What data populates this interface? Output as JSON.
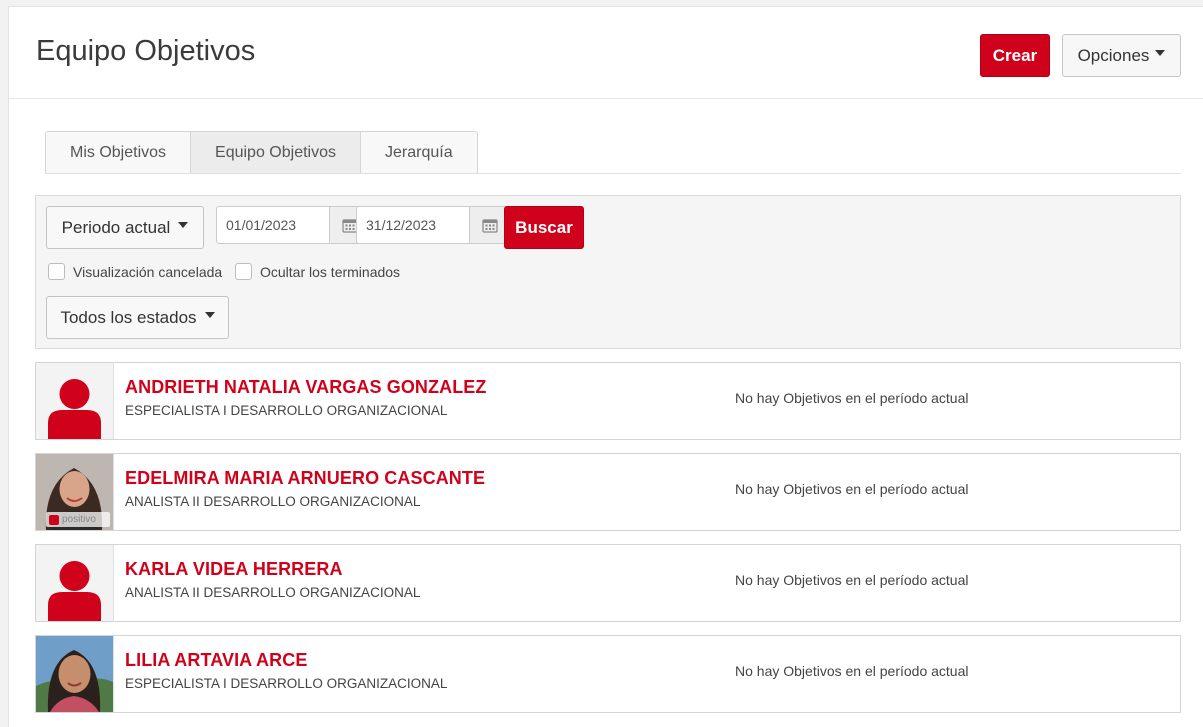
{
  "header": {
    "title": "Equipo Objetivos",
    "create_label": "Crear",
    "options_label": "Opciones"
  },
  "tabs": [
    {
      "label": "Mis Objetivos",
      "active": false
    },
    {
      "label": "Equipo Objetivos",
      "active": true
    },
    {
      "label": "Jerarquía",
      "active": false
    }
  ],
  "filters": {
    "period_label": "Periodo actual",
    "date_from": "01/01/2023",
    "date_to": "31/12/2023",
    "search_label": "Buscar",
    "show_cancelled_label": "Visualización cancelada",
    "hide_finished_label": "Ocultar los terminados",
    "states_label": "Todos los estados"
  },
  "people": [
    {
      "name": "ANDRIETH NATALIA VARGAS GONZALEZ",
      "role": "ESPECIALISTA I DESARROLLO ORGANIZACIONAL",
      "status": "No hay Objetivos en el período actual",
      "avatar": "placeholder"
    },
    {
      "name": "EDELMIRA MARIA ARNUERO CASCANTE",
      "role": "ANALISTA II DESARROLLO ORGANIZACIONAL",
      "status": "No hay Objetivos en el período actual",
      "avatar": "photo",
      "badge": "positivo"
    },
    {
      "name": "KARLA VIDEA HERRERA",
      "role": "ANALISTA II DESARROLLO ORGANIZACIONAL",
      "status": "No hay Objetivos en el período actual",
      "avatar": "placeholder"
    },
    {
      "name": "LILIA ARTAVIA ARCE",
      "role": "ESPECIALISTA I DESARROLLO ORGANIZACIONAL",
      "status": "No hay Objetivos en el período actual",
      "avatar": "photo"
    }
  ],
  "colors": {
    "accent": "#d0021b",
    "text": "#333333",
    "border": "#d5d5d5"
  },
  "icons": [
    "caret-down-icon",
    "calendar-icon",
    "user-placeholder-icon"
  ]
}
